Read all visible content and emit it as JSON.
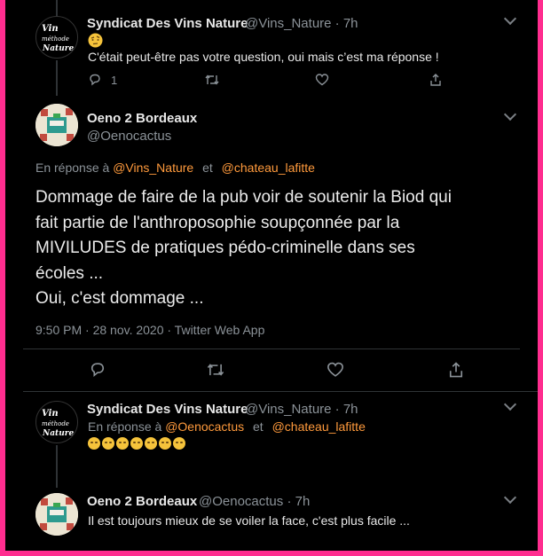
{
  "tweet1": {
    "name": "Syndicat Des Vins Nature",
    "handle": "@Vins_Nature",
    "time": "· 7h",
    "emoji_icon": "raised-eyebrow-face-icon",
    "text": "C'était peut-être pas votre question, oui mais c’est ma réponse !",
    "reply_count": "1",
    "avatar_text": "Vin méthode Nature"
  },
  "main_tweet": {
    "name": "Oeno 2 Bordeaux",
    "handle": "@Oenocactus",
    "reply_prefix": "En réponse à",
    "reply_to_1": "@Vins_Nature",
    "reply_and": "et",
    "reply_to_2": "@chateau_lafitte",
    "text_lines": [
      "Dommage de faire de la pub voir de soutenir la Biod qui",
      "fait partie de l'anthroposophie soupçonnée par la",
      "MIVILUDES de pratiques pédo-criminelle dans ses",
      "écoles ...",
      "Oui, c'est dommage ..."
    ],
    "meta": "9:50 PM · 28 nov. 2020 · Twitter Web App"
  },
  "tweet3": {
    "name": "Syndicat Des Vins Nature",
    "handle": "@Vins_Nature",
    "time": "· 7h",
    "reply_prefix": "En réponse à",
    "reply_to_1": "@Oenocactus",
    "reply_and": "et",
    "reply_to_2": "@chateau_lafitte",
    "emoji_icon": "sleeping-face-icon",
    "emoji_count": 7
  },
  "tweet4": {
    "name": "Oeno 2 Bordeaux",
    "handle": "@Oenocactus",
    "time": "· 7h",
    "text": "Il est toujours mieux de se voiler la face, c'est plus facile ..."
  },
  "colors": {
    "frame_border": "#ff2d8f",
    "link": "#ff9a3c",
    "muted": "#8b9298"
  }
}
